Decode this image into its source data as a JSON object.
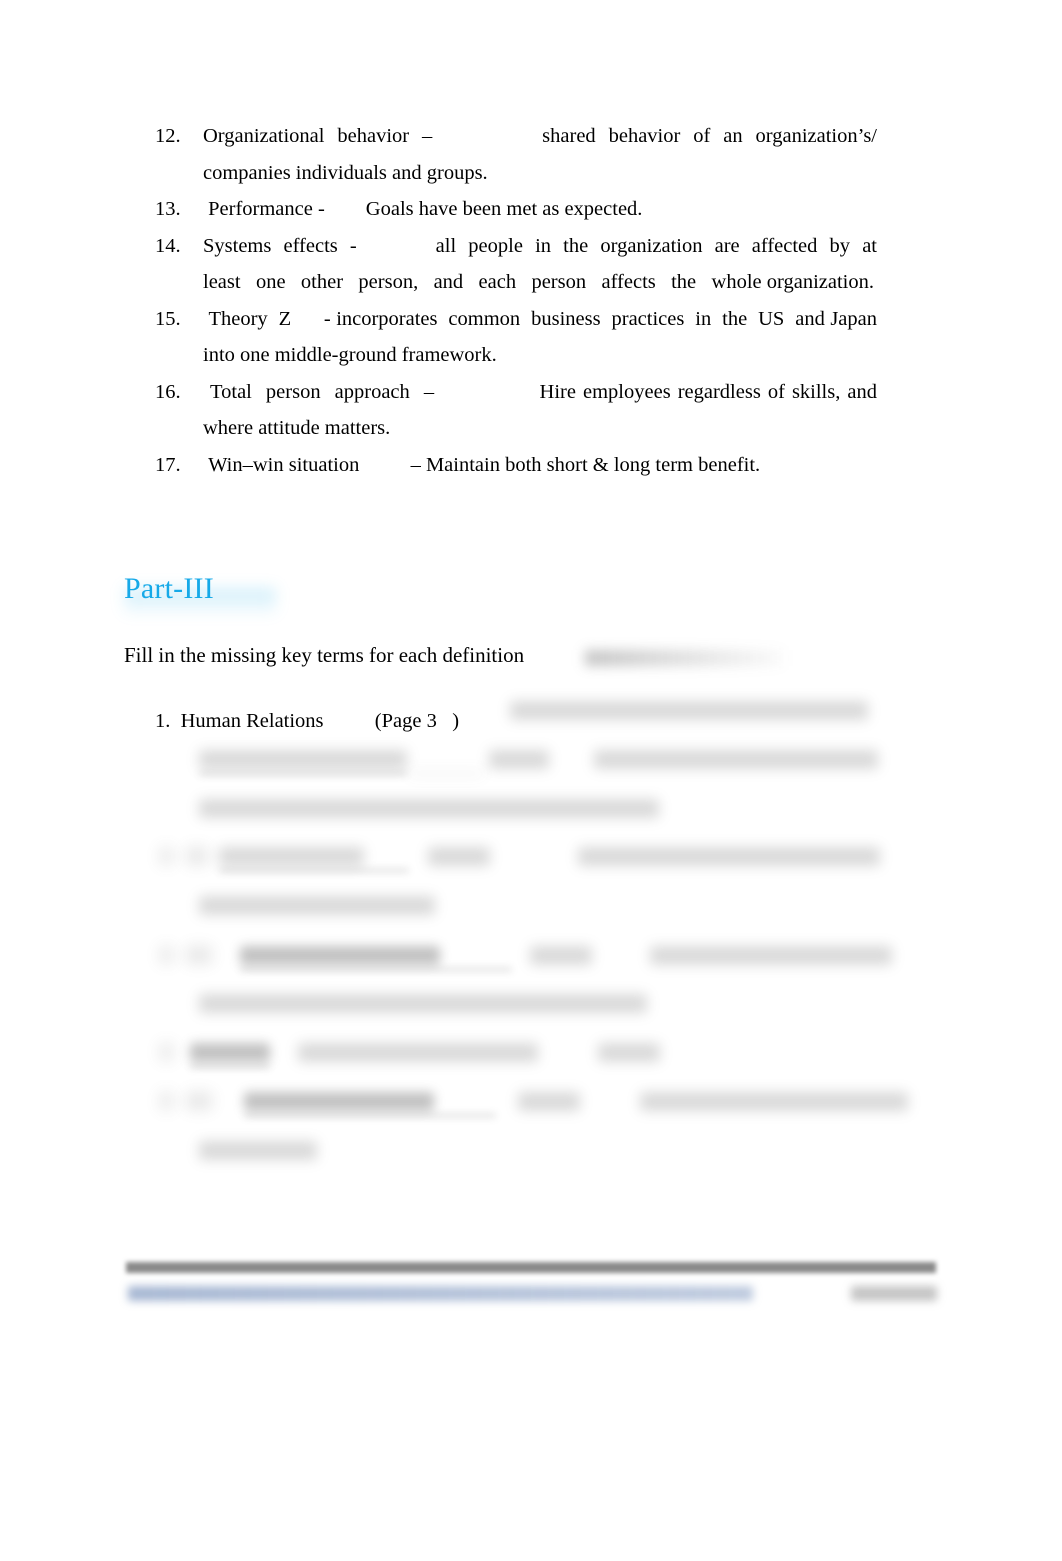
{
  "document": {
    "background_color": "#ffffff",
    "text_color": "#000000"
  },
  "definition_list": {
    "items": [
      {
        "number": "12.",
        "text": "Organizational  behavior  –                 shared  behavior  of  an  organization’s/ companies individuals and groups."
      },
      {
        "number": "13.",
        "text": " Performance -        Goals have been met as expected."
      },
      {
        "number": "14.",
        "text": "Systems  effects  -             all  people  in  the  organization  are  affected  by  at least   one   other   person,   and   each   person   affects   the   whole organization."
      },
      {
        "number": "15.",
        "text": " Theory  Z      - incorporates  common  business  practices  in  the  US  and Japan into one middle-ground framework."
      },
      {
        "number": "16.",
        "text": " Total  person  approach  –               Hire employees regardless of skills, and where attitude matters."
      },
      {
        "number": "17.",
        "text": " Win–win situation          – Maintain both short & long term benefit."
      }
    ]
  },
  "part_three": {
    "heading": "Part-III",
    "heading_color": "#16a9e8",
    "instruction": "Fill in the missing key terms for each definition",
    "items": [
      {
        "number": "1.",
        "visible_text": "  Human Relations          (Page 3   )",
        "redacted": true
      },
      {
        "number": "",
        "visible_text": "",
        "redacted": true
      },
      {
        "number": "",
        "visible_text": "",
        "redacted": true
      },
      {
        "number": "",
        "visible_text": "",
        "redacted": true
      },
      {
        "number": "",
        "visible_text": "",
        "redacted": true
      }
    ]
  },
  "footer": {
    "rule_color": "#8a8a8a",
    "text_redacted": true,
    "page_number_redacted": true
  }
}
